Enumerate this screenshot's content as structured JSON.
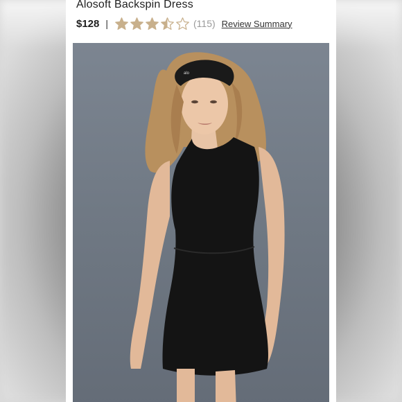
{
  "product": {
    "title": "Alosoft Backspin Dress",
    "price": "$128",
    "separator": "|",
    "rating": 3.5,
    "rating_max": 5,
    "review_count": "(115)",
    "review_summary_link": "Review Summary"
  },
  "colors": {
    "star_fill": "#c8b08c",
    "star_empty": "#ffffff",
    "star_outline": "#c8b08c",
    "dress": "#141414",
    "headband": "#1a1a1a",
    "background": "#717a85"
  },
  "image": {
    "subject": "model-wearing-black-dress",
    "headband_logo": "alo"
  }
}
